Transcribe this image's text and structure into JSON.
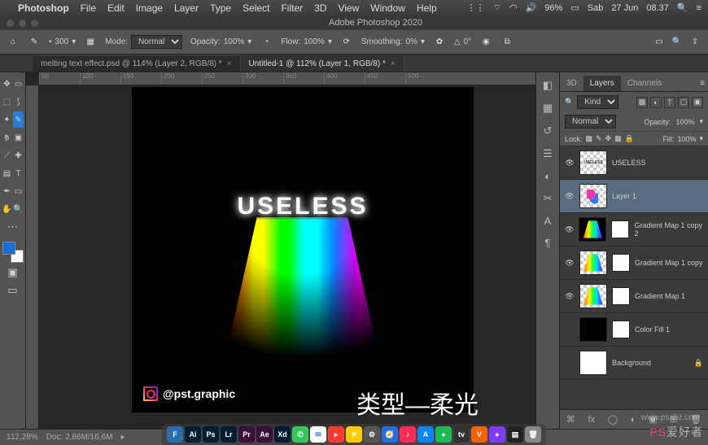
{
  "menubar": {
    "app": "Photoshop",
    "items": [
      "File",
      "Edit",
      "Image",
      "Layer",
      "Type",
      "Select",
      "Filter",
      "3D",
      "View",
      "Window",
      "Help"
    ],
    "status": {
      "battery": "96%",
      "day": "Sab",
      "date": "27 Jun",
      "time": "08.37"
    }
  },
  "window_title": "Adobe Photoshop 2020",
  "options": {
    "size_label": "300",
    "mode_label": "Mode:",
    "mode": "Normal",
    "opacity_label": "Opacity:",
    "opacity": "100%",
    "flow_label": "Flow:",
    "flow": "100%",
    "smoothing_label": "Smoothing:",
    "smoothing": "0%",
    "angle": "0°"
  },
  "tabs": [
    {
      "label": "melting text effect.psd @ 114% (Layer 2, RGB/8) *",
      "active": false
    },
    {
      "label": "Untitled-1 @ 112% (Layer 1, RGB/8) *",
      "active": true
    }
  ],
  "ruler": [
    "50",
    "100",
    "150",
    "200",
    "250",
    "300",
    "350",
    "400",
    "450",
    "500"
  ],
  "canvas": {
    "headline": "USELESS",
    "handle": "@pst.graphic",
    "overlay": "类型—柔光"
  },
  "panels": {
    "tabs": [
      "3D",
      "Layers",
      "Channels"
    ],
    "active": "Layers",
    "filter": {
      "kind": "Kind"
    },
    "blend": {
      "mode": "Normal",
      "opacity_label": "Opacity:",
      "opacity": "100%"
    },
    "lock": {
      "label": "Lock:",
      "fill_label": "Fill:",
      "fill": "100%"
    },
    "layers": [
      {
        "name": "USELESS",
        "thumb": "useless-t",
        "mask": false,
        "eye": true,
        "sel": false
      },
      {
        "name": "Layer 1",
        "thumb": "blob",
        "mask": false,
        "eye": true,
        "sel": true
      },
      {
        "name": "Gradient Map 1 copy 2",
        "thumb": "rainbow-t",
        "mask": true,
        "eye": true,
        "sel": false,
        "blackbg": true
      },
      {
        "name": "Gradient Map 1 copy",
        "thumb": "rainbow-t",
        "mask": true,
        "eye": true,
        "sel": false
      },
      {
        "name": "Gradient Map 1",
        "thumb": "rainbow-t",
        "mask": true,
        "eye": true,
        "sel": false
      },
      {
        "name": "Color Fill 1",
        "thumb": "black",
        "mask": true,
        "eye": false,
        "sel": false
      },
      {
        "name": "Background",
        "thumb": "white",
        "mask": false,
        "eye": false,
        "sel": false,
        "locked": true
      }
    ]
  },
  "status": {
    "zoom": "112,28%",
    "doc": "Doc: 2,86M/16,6M"
  },
  "dock": [
    {
      "bg": "#2b6cb0",
      "t": "F"
    },
    {
      "bg": "#001d34",
      "t": "Ai"
    },
    {
      "bg": "#001d34",
      "t": "Ps"
    },
    {
      "bg": "#001d34",
      "t": "Lr"
    },
    {
      "bg": "#3a0d3a",
      "t": "Pr"
    },
    {
      "bg": "#3a0d3a",
      "t": "Ae"
    },
    {
      "bg": "#001d34",
      "t": "Xd"
    },
    {
      "bg": "#34c759",
      "t": "✆"
    },
    {
      "bg": "#fff",
      "t": "✉",
      "c": "#3b82f6"
    },
    {
      "bg": "#ff3b30",
      "t": "▸"
    },
    {
      "bg": "#ffcc00",
      "t": "☀"
    },
    {
      "bg": "#555",
      "t": "⚙"
    },
    {
      "bg": "#1f6feb",
      "t": "🧭"
    },
    {
      "bg": "#ff2d55",
      "t": "♪"
    },
    {
      "bg": "#0a84ff",
      "t": "A"
    },
    {
      "bg": "#1db954",
      "t": "●"
    },
    {
      "bg": "#333",
      "t": "tv"
    },
    {
      "bg": "#f56300",
      "t": "V"
    },
    {
      "bg": "#7d3cff",
      "t": "●"
    },
    {
      "bg": "#222",
      "t": "▤"
    },
    {
      "bg": "#888",
      "t": "🗑"
    }
  ],
  "watermark": {
    "site": "www.psahz.com",
    "brand_a": "PS",
    "brand_b": "爱好者"
  }
}
